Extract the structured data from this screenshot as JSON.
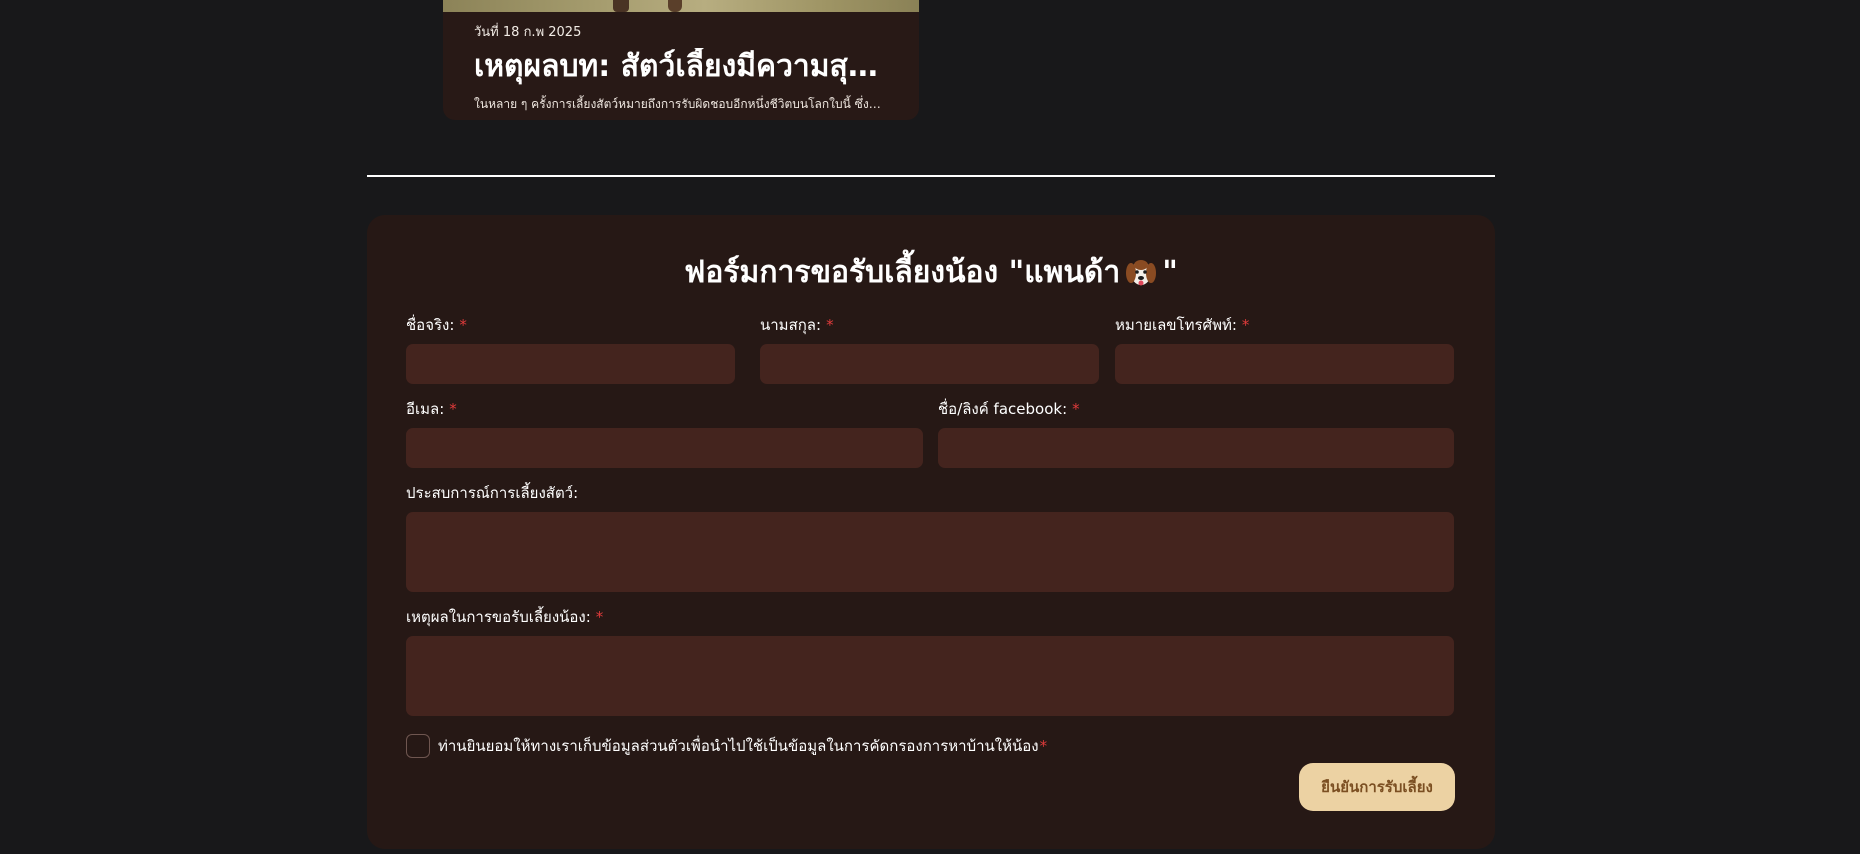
{
  "blog_card": {
    "date": "วันที่ 18 ก.พ 2025",
    "title": "เหตุผลบท: สัตว์เลี้ยงมีความสุข ...",
    "excerpt": "ในหลาย ๆ ครั้งการเลี้ยงสัตว์หมายถึงการรับผิดชอบอีกหนึ่งชีวิตบนโลกใบนี้ ซึ่งฟังดูเป็น..."
  },
  "form": {
    "title_before": "ฟอร์มการขอรับเลี้ยงน้อง \"แพนด้า",
    "title_after": "\"",
    "title_icon": "dog-emoji-icon",
    "required_mark": "*",
    "fields": {
      "first_name": {
        "label": "ชื่อจริง:",
        "required": true,
        "value": ""
      },
      "last_name": {
        "label": "นามสกุล:",
        "required": true,
        "value": ""
      },
      "phone": {
        "label": "หมายเลขโทรศัพท์:",
        "required": true,
        "value": ""
      },
      "email": {
        "label": "อีเมล:",
        "required": true,
        "value": ""
      },
      "facebook": {
        "label": "ชื่อ/ลิงค์ facebook:",
        "required": true,
        "value": ""
      },
      "experience": {
        "label": "ประสบการณ์การเลี้ยงสัตว์:",
        "required": false,
        "value": ""
      },
      "reason": {
        "label": "เหตุผลในการขอรับเลี้ยงน้อง:",
        "required": true,
        "value": ""
      }
    },
    "consent": {
      "label": "ท่านยินยอมให้ทางเราเก็บข้อมูลส่วนตัวเพื่อนำไปใช้เป็นข้อมูลในการคัดกรองการหาบ้านให้น้อง",
      "checked": false
    },
    "submit_label": "ยืนยันการรับเลี้ยง"
  },
  "colors": {
    "page_bg": "#18181a",
    "panel_bg": "#261815",
    "input_bg": "#44241e",
    "required": "#e03b3b",
    "button_bg": "#ecd2a3",
    "button_text": "#7b4f22"
  }
}
